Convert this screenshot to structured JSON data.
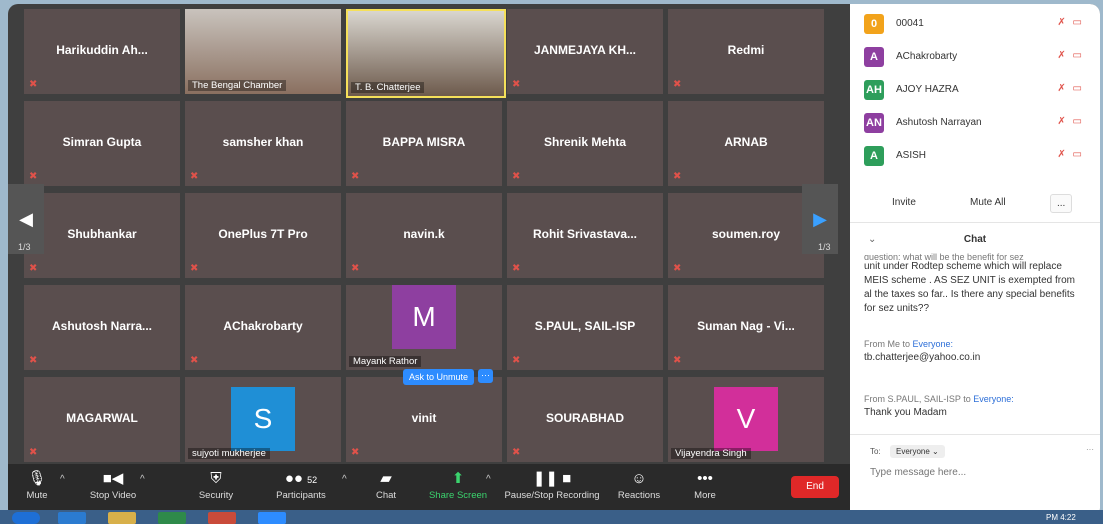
{
  "tiles": [
    {
      "name": "Harikuddin  Ah...",
      "type": "name"
    },
    {
      "name": "",
      "label": "The Bengal Chamber",
      "type": "video"
    },
    {
      "name": "",
      "label": "T. B. Chatterjee",
      "type": "video"
    },
    {
      "name": "JANMEJAYA KH...",
      "type": "name"
    },
    {
      "name": "Redmi",
      "type": "name"
    },
    {
      "name": "Simran Gupta",
      "type": "name"
    },
    {
      "name": "samsher khan",
      "type": "name"
    },
    {
      "name": "BAPPA MISRA",
      "type": "name"
    },
    {
      "name": "Shrenik Mehta",
      "type": "name"
    },
    {
      "name": "ARNAB",
      "type": "name"
    },
    {
      "name": "Shubhankar",
      "type": "name"
    },
    {
      "name": "OnePlus 7T Pro",
      "type": "name"
    },
    {
      "name": "navin.k",
      "type": "name"
    },
    {
      "name": "Rohit  Srivastava...",
      "type": "name"
    },
    {
      "name": "soumen.roy",
      "type": "name"
    },
    {
      "name": "Ashutosh Narra...",
      "type": "name"
    },
    {
      "name": "AChakrobarty",
      "type": "name"
    },
    {
      "name": "",
      "label": "Mayank Rathor",
      "avatar": "M",
      "avatar_color": "#8e3fa0",
      "type": "avatar"
    },
    {
      "name": "S.PAUL, SAIL-ISP",
      "type": "name"
    },
    {
      "name": "Suman Nag - Vi...",
      "type": "name"
    },
    {
      "name": "MAGARWAL",
      "type": "name"
    },
    {
      "name": "",
      "label": "sujyoti mukherjee",
      "avatar": "S",
      "avatar_color": "#1f8fd6",
      "type": "avatar"
    },
    {
      "name": "vinit",
      "type": "name"
    },
    {
      "name": "SOURABHAD",
      "type": "name"
    },
    {
      "name": "",
      "label": "Vijayendra Singh",
      "avatar": "V",
      "avatar_color": "#d22f9a",
      "type": "avatar"
    }
  ],
  "pagination": {
    "left": "1/3",
    "right": "1/3"
  },
  "ask_unmute": "Ask to Unmute",
  "more_dots": "···",
  "toolbar": {
    "mute": "Mute",
    "stop_video": "Stop Video",
    "security": "Security",
    "participants": "Participants",
    "participants_count": "52",
    "chat": "Chat",
    "share_screen": "Share Screen",
    "record": "Pause/Stop Recording",
    "reactions": "Reactions",
    "more": "More",
    "end": "End"
  },
  "participants": [
    {
      "avatar": "0",
      "name": "00041",
      "color": "#f2a31b"
    },
    {
      "avatar": "A",
      "name": "AChakrobarty",
      "color": "#8e3fa0"
    },
    {
      "avatar": "AH",
      "name": "AJOY HAZRA",
      "color": "#2e9e5b"
    },
    {
      "avatar": "AN",
      "name": "Ashutosh Narrayan",
      "color": "#8e3fa0"
    },
    {
      "avatar": "A",
      "name": "ASISH",
      "color": "#2e9e5b"
    }
  ],
  "panel_buttons": {
    "invite": "Invite",
    "mute_all": "Mute All",
    "more": "..."
  },
  "chat": {
    "title": "Chat",
    "partial": "question: what will be the benefit for sez",
    "msg1": "unit under Rodtep scheme which will replace MEIS scheme . AS SEZ UNIT is exempted from al the taxes so far.. Is there any special benefits for sez units??",
    "from1_prefix": "From Me to ",
    "from1_to": "Everyone:",
    "msg2": "tb.chatterjee@yahoo.co.in",
    "from2_prefix": "From S.PAUL, SAIL-ISP to ",
    "from2_to": "Everyone:",
    "msg3": "Thank you Madam",
    "to_label": "To:",
    "to_value": "Everyone",
    "placeholder": "Type message here..."
  },
  "clock": "PM 4:22"
}
